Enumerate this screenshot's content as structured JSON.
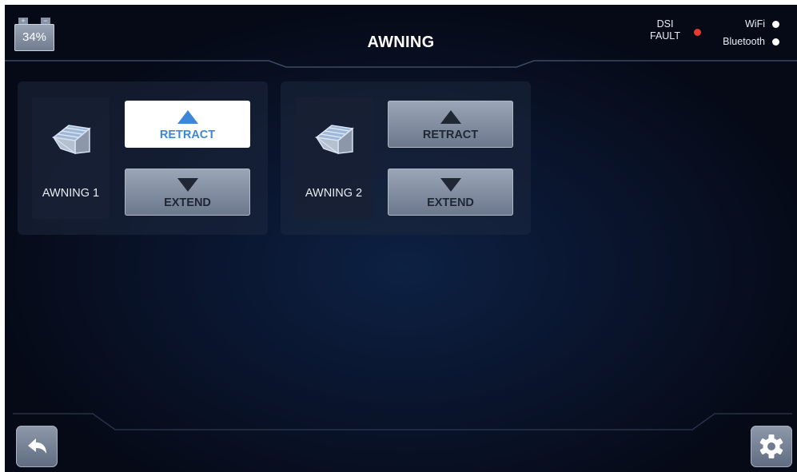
{
  "header": {
    "battery_percent": "34%",
    "battery_plus": "+",
    "battery_minus": "−",
    "title": "AWNING",
    "dsi_line1": "DSI",
    "dsi_line2": "FAULT",
    "dsi_status_color": "#e53a2f",
    "wifi_label": "WiFi",
    "bluetooth_label": "Bluetooth"
  },
  "awnings": [
    {
      "label": "AWNING 1",
      "icon": "awning-icon",
      "retract_label": "RETRACT",
      "extend_label": "EXTEND",
      "active": "retract"
    },
    {
      "label": "AWNING 2",
      "icon": "awning-icon",
      "retract_label": "RETRACT",
      "extend_label": "EXTEND",
      "active": "none"
    }
  ],
  "footer": {
    "back_icon": "back-arrow-icon",
    "settings_icon": "gear-icon"
  },
  "colors": {
    "active_accent": "#3d86d8",
    "button_gray": "#8591a4",
    "background": "#0a1630"
  }
}
